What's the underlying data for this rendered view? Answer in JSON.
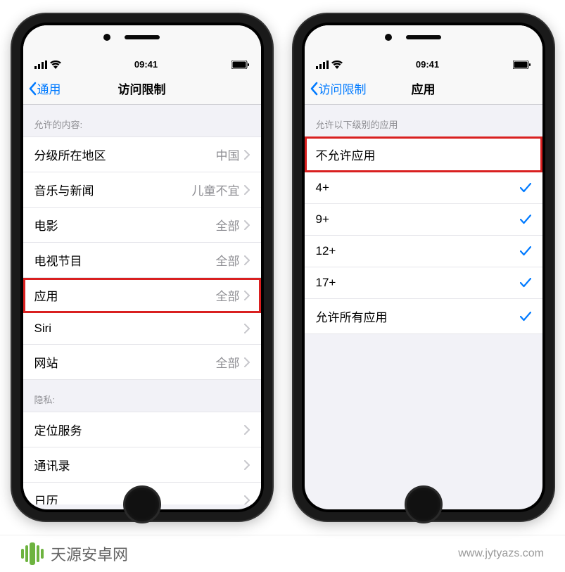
{
  "status": {
    "time": "09:41"
  },
  "phone1": {
    "back": "通用",
    "title": "访问限制",
    "section1_header": "允许的内容:",
    "section2_header": "隐私:",
    "rows1": [
      {
        "label": "分级所在地区",
        "value": "中国",
        "highlighted": false
      },
      {
        "label": "音乐与新闻",
        "value": "儿童不宜",
        "highlighted": false
      },
      {
        "label": "电影",
        "value": "全部",
        "highlighted": false
      },
      {
        "label": "电视节目",
        "value": "全部",
        "highlighted": false
      },
      {
        "label": "应用",
        "value": "全部",
        "highlighted": true
      },
      {
        "label": "Siri",
        "value": "",
        "highlighted": false
      },
      {
        "label": "网站",
        "value": "全部",
        "highlighted": false
      }
    ],
    "rows2": [
      {
        "label": "定位服务",
        "value": ""
      },
      {
        "label": "通讯录",
        "value": ""
      },
      {
        "label": "日历",
        "value": ""
      }
    ]
  },
  "phone2": {
    "back": "访问限制",
    "title": "应用",
    "section_header": "允许以下级别的应用",
    "rows": [
      {
        "label": "不允许应用",
        "checked": false,
        "highlighted": true
      },
      {
        "label": "4+",
        "checked": true,
        "highlighted": false
      },
      {
        "label": "9+",
        "checked": true,
        "highlighted": false
      },
      {
        "label": "12+",
        "checked": true,
        "highlighted": false
      },
      {
        "label": "17+",
        "checked": true,
        "highlighted": false
      },
      {
        "label": "允许所有应用",
        "checked": true,
        "highlighted": false
      }
    ]
  },
  "watermark": {
    "brand": "天源安卓网",
    "url": "www.jytyazs.com"
  }
}
